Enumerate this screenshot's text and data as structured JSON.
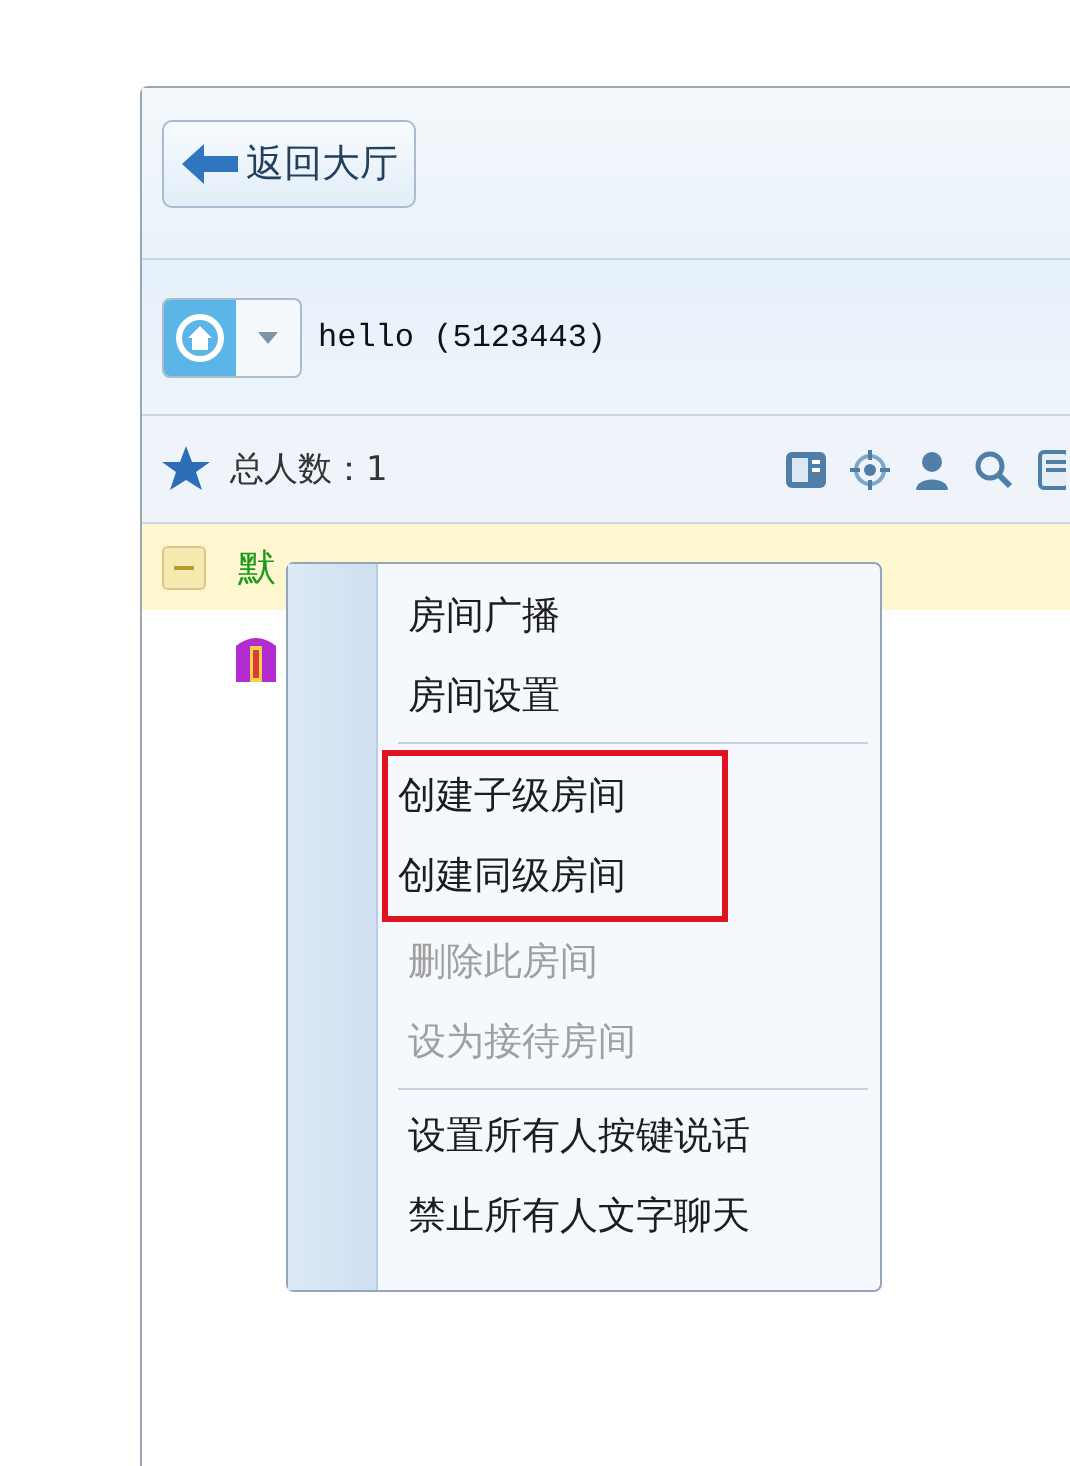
{
  "toolbar": {
    "back_button": "返回大厅"
  },
  "room_bar": {
    "room": "hello (5123443)"
  },
  "stats_bar": {
    "total": "总人数：1"
  },
  "tree": {
    "room": {
      "name": "默",
      "expanded": true
    }
  },
  "context_menu": {
    "groups": [
      [
        {
          "label": "房间广播",
          "disabled": false,
          "highlighted": false
        },
        {
          "label": "房间设置",
          "disabled": false,
          "highlighted": false
        }
      ],
      [
        {
          "label": "创建子级房间",
          "disabled": false,
          "highlighted": true
        },
        {
          "label": "创建同级房间",
          "disabled": false,
          "highlighted": true
        },
        {
          "label": "删除此房间",
          "disabled": true,
          "highlighted": false
        },
        {
          "label": "设为接待房间",
          "disabled": true,
          "highlighted": false
        }
      ],
      [
        {
          "label": "设置所有人按键说话",
          "disabled": false,
          "highlighted": false
        },
        {
          "label": "禁止所有人文字聊天",
          "disabled": false,
          "highlighted": false
        }
      ]
    ]
  }
}
